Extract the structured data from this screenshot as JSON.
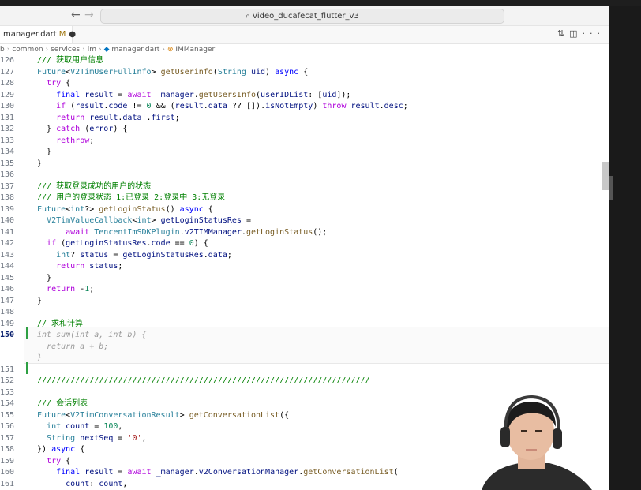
{
  "window": {
    "search_text": "video_ducafecat_flutter_v3",
    "back_icon": "arrow-left-icon",
    "forward_icon": "arrow-right-icon"
  },
  "tab": {
    "name": "manager.dart",
    "status": "M",
    "dirty_marker": "●"
  },
  "breadcrumb": [
    "b",
    "common",
    "services",
    "im",
    "manager.dart",
    "IMManager"
  ],
  "editor": {
    "lines": [
      {
        "n": "126",
        "html": "<span class='cm'>/// 获取用户信息</span>",
        "indent": 0
      },
      {
        "n": "127",
        "html": "<span class='ty'>Future</span>&lt;<span class='ty'>V2TimUserFullInfo</span>&gt; <span class='fn'>getUserinfo</span>(<span class='ty'>String</span> <span class='var'>uid</span>) <span class='kw'>async</span> {",
        "indent": 0
      },
      {
        "n": "128",
        "html": "  <span class='ctl'>try</span> {",
        "indent": 0
      },
      {
        "n": "129",
        "html": "    <span class='kw'>final</span> <span class='var'>result</span> = <span class='ctl'>await</span> <span class='var'>_manager</span>.<span class='fn'>getUsersInfo</span>(<span class='var'>userIDList</span>: [<span class='var'>uid</span>]);",
        "indent": 0
      },
      {
        "n": "130",
        "html": "    <span class='ctl'>if</span> (<span class='var'>result</span>.<span class='var'>code</span> != <span class='num'>0</span> &amp;&amp; (<span class='var'>result</span>.<span class='var'>data</span> ?? []).<span class='var'>isNotEmpty</span>) <span class='ctl'>throw</span> <span class='var'>result</span>.<span class='var'>desc</span>;",
        "indent": 0
      },
      {
        "n": "131",
        "html": "    <span class='ctl'>return</span> <span class='var'>result</span>.<span class='var'>data</span>!.<span class='var'>first</span>;",
        "indent": 0
      },
      {
        "n": "132",
        "html": "  } <span class='ctl'>catch</span> (<span class='var'>error</span>) {",
        "indent": 0
      },
      {
        "n": "133",
        "html": "    <span class='ctl'>rethrow</span>;",
        "indent": 0
      },
      {
        "n": "134",
        "html": "  }",
        "indent": 0
      },
      {
        "n": "135",
        "html": "}",
        "indent": 0
      },
      {
        "n": "136",
        "html": "",
        "indent": 0
      },
      {
        "n": "137",
        "html": "<span class='cm'>/// 获取登录成功的用户的状态</span>",
        "indent": 0
      },
      {
        "n": "138",
        "html": "<span class='cm'>/// 用户的登录状态 1:已登录 2:登录中 3:无登录</span>",
        "indent": 0
      },
      {
        "n": "139",
        "html": "<span class='ty'>Future</span>&lt;<span class='ty'>int</span>?&gt; <span class='fn'>getLoginStatus</span>() <span class='kw'>async</span> {",
        "indent": 0
      },
      {
        "n": "140",
        "html": "  <span class='ty'>V2TimValueCallback</span>&lt;<span class='ty'>int</span>&gt; <span class='var'>getLoginStatusRes</span> =",
        "indent": 0
      },
      {
        "n": "141",
        "html": "      <span class='ctl'>await</span> <span class='ty'>TencentImSDKPlugin</span>.<span class='var'>v2TIMManager</span>.<span class='fn'>getLoginStatus</span>();",
        "indent": 0
      },
      {
        "n": "142",
        "html": "  <span class='ctl'>if</span> (<span class='var'>getLoginStatusRes</span>.<span class='var'>code</span> == <span class='num'>0</span>) {",
        "indent": 0
      },
      {
        "n": "143",
        "html": "    <span class='ty'>int</span>? <span class='var'>status</span> = <span class='var'>getLoginStatusRes</span>.<span class='var'>data</span>;",
        "indent": 0
      },
      {
        "n": "144",
        "html": "    <span class='ctl'>return</span> <span class='var'>status</span>;",
        "indent": 0
      },
      {
        "n": "145",
        "html": "  }",
        "indent": 0
      },
      {
        "n": "146",
        "html": "  <span class='ctl'>return</span> -<span class='num'>1</span>;",
        "indent": 0
      },
      {
        "n": "147",
        "html": "}",
        "indent": 0
      },
      {
        "n": "148",
        "html": "",
        "indent": 0
      },
      {
        "n": "149",
        "html": "<span class='cm'>// 求和计算</span>",
        "indent": 0
      },
      {
        "n": "150",
        "html": "<span class='ghost'>int sum(int a, int b) {</span>",
        "indent": 0,
        "active": true
      },
      {
        "n": "",
        "html": "<span class='ghost'>  return a + b;</span>",
        "indent": 0
      },
      {
        "n": "",
        "html": "<span class='ghost'>}</span>",
        "indent": 0
      },
      {
        "n": "151",
        "html": "",
        "indent": 0
      },
      {
        "n": "152",
        "html": "<span class='cm'>//////////////////////////////////////////////////////////////////////</span>",
        "indent": 0
      },
      {
        "n": "153",
        "html": "",
        "indent": 0
      },
      {
        "n": "154",
        "html": "<span class='cm'>/// 会话列表</span>",
        "indent": 0
      },
      {
        "n": "155",
        "html": "<span class='ty'>Future</span>&lt;<span class='ty'>V2TimConversationResult</span>&gt; <span class='fn'>getConversationList</span>({",
        "indent": 0
      },
      {
        "n": "156",
        "html": "  <span class='ty'>int</span> <span class='var'>count</span> = <span class='num'>100</span>,",
        "indent": 0
      },
      {
        "n": "157",
        "html": "  <span class='ty'>String</span> <span class='var'>nextSeq</span> = <span class='str'>'0'</span>,",
        "indent": 0
      },
      {
        "n": "158",
        "html": "}) <span class='kw'>async</span> {",
        "indent": 0
      },
      {
        "n": "159",
        "html": "  <span class='ctl'>try</span> {",
        "indent": 0
      },
      {
        "n": "160",
        "html": "    <span class='kw'>final</span> <span class='var'>result</span> = <span class='ctl'>await</span> <span class='var'>_manager</span>.<span class='var'>v2ConversationManager</span>.<span class='fn'>getConversationList</span>(",
        "indent": 0
      },
      {
        "n": "161",
        "html": "      <span class='var'>count</span>: <span class='var'>count</span>,",
        "indent": 0
      }
    ]
  }
}
